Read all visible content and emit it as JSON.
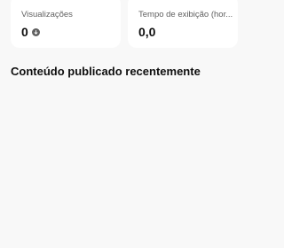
{
  "stats": {
    "views": {
      "label": "Visualizações",
      "value": "0",
      "icon": "trend-neutral-icon"
    },
    "watch_time": {
      "label": "Tempo de exibição (hor...",
      "value": "0,0"
    }
  },
  "recent_content": {
    "title": "Conteúdo publicado recentemente"
  }
}
